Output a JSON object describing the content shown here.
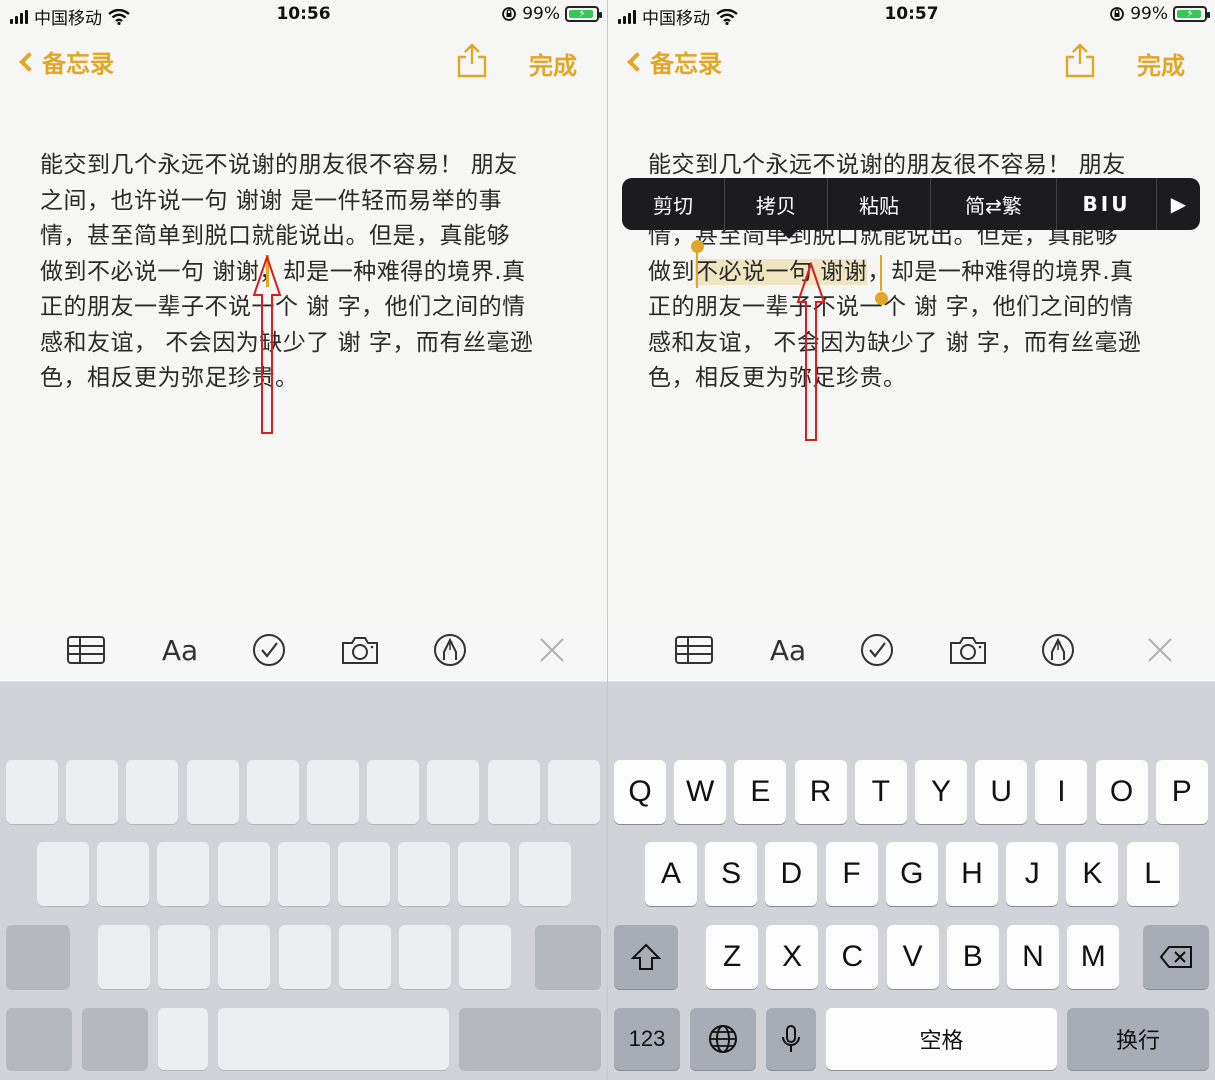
{
  "status_left": {
    "carrier": "中国移动",
    "time": "10:56",
    "battery": "99%"
  },
  "status_right": {
    "carrier": "中国移动",
    "time": "10:57",
    "battery": "99%"
  },
  "nav": {
    "back_label": "备忘录",
    "done_label": "完成"
  },
  "note_lines": [
    "能交到几个永远不说谢的朋友很不容易！ 朋友",
    "之间，也许说一句 谢谢 是一件轻而易举的事",
    "情，甚至简单到脱口就能说出。但是，真能够",
    "做到不必说一句 谢谢，却是一种难得的境界.真",
    "正的朋友一辈子不说一个 谢 字，他们之间的情",
    "感和友谊， 不会因为缺少了 谢 字，而有丝毫逊",
    "色，相反更为弥足珍贵。"
  ],
  "selection": {
    "before": "做到",
    "selected": "不必说一句 谢谢",
    "after": "，却是一种难得的境界.真"
  },
  "edit_menu": {
    "cut": "剪切",
    "copy": "拷贝",
    "paste": "粘贴",
    "convert": "简⇄繁",
    "format": "BIU",
    "more": "▶"
  },
  "toolbar": {
    "format_label": "Aa"
  },
  "keyboard": {
    "row1": [
      "Q",
      "W",
      "E",
      "R",
      "T",
      "Y",
      "U",
      "I",
      "O",
      "P"
    ],
    "row2": [
      "A",
      "S",
      "D",
      "F",
      "G",
      "H",
      "J",
      "K",
      "L"
    ],
    "row3": [
      "Z",
      "X",
      "C",
      "V",
      "B",
      "N",
      "M"
    ],
    "numbers_label": "123",
    "space_label": "空格",
    "return_label": "换行"
  },
  "colors": {
    "accent": "#e0a628",
    "annotation": "#d42020",
    "menu_bg": "#1c1c1e"
  }
}
